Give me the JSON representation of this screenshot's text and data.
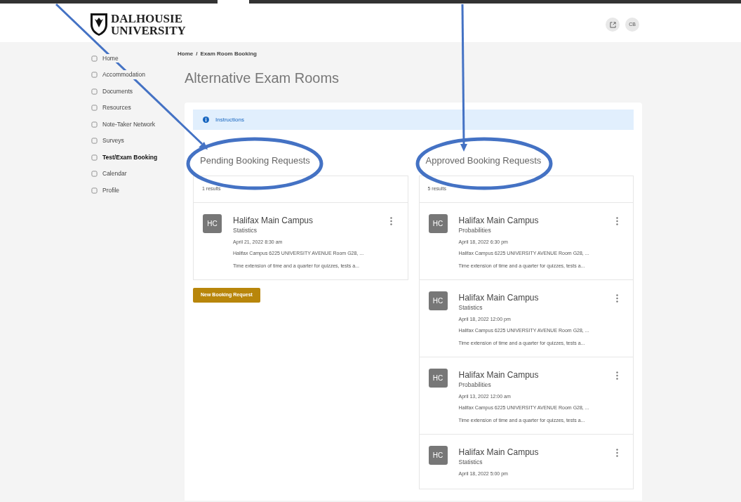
{
  "header": {
    "logo_line_1": "DALHOUSIE",
    "logo_line_2": "UNIVERSITY",
    "user_initials": "CB"
  },
  "sidebar": {
    "items": [
      {
        "label": "Home",
        "selected": false
      },
      {
        "label": "Accommodation",
        "selected": false
      },
      {
        "label": "Documents",
        "selected": false
      },
      {
        "label": "Resources",
        "selected": false
      },
      {
        "label": "Note-Taker Network",
        "selected": false
      },
      {
        "label": "Surveys",
        "selected": false
      },
      {
        "label": "Test/Exam Booking",
        "selected": true
      },
      {
        "label": "Calendar",
        "selected": false
      },
      {
        "label": "Profile",
        "selected": false
      }
    ]
  },
  "breadcrumb": [
    "Home",
    "/",
    "Exam Room Booking"
  ],
  "title": "Alternative Exam Rooms",
  "instructions": "Instructions",
  "columns": [
    {
      "heading": "Pending Booking Requests",
      "count": "1 results",
      "items": [
        {
          "initials": "HC",
          "campus": "Halifax Main Campus",
          "course": "Statistics",
          "date": "April 21, 2022 8:30 am",
          "location": "Halifax Campus 6225 UNIVERSITY AVENUE Room G28, ...",
          "note": "Time extension of time and a quarter for quizzes, tests a..."
        }
      ],
      "button": "New Booking Request"
    },
    {
      "heading": "Approved Booking Requests",
      "count": "5 results",
      "items": [
        {
          "initials": "HC",
          "campus": "Halifax Main Campus",
          "course": "Probabilities",
          "date": "April 18, 2022 6:30 pm",
          "location": "Halifax Campus 6225 UNIVERSITY AVENUE Room G28, ...",
          "note": "Time extension of time and a quarter for quizzes, tests a..."
        },
        {
          "initials": "HC",
          "campus": "Halifax Main Campus",
          "course": "Statistics",
          "date": "April 18, 2022 12:00 pm",
          "location": "Halifax Campus 6225 UNIVERSITY AVENUE Room G28, ...",
          "note": "Time extension of time and a quarter for quizzes, tests a..."
        },
        {
          "initials": "HC",
          "campus": "Halifax Main Campus",
          "course": "Probabilities",
          "date": "April 13, 2022 12:00 am",
          "location": "Halifax Campus 6225 UNIVERSITY AVENUE Room G28, ...",
          "note": "Time extension of time and a quarter for quizzes, tests a..."
        },
        {
          "initials": "HC",
          "campus": "Halifax Main Campus",
          "course": "Statistics",
          "date": "April 18, 2022 5:00 pm"
        }
      ]
    }
  ]
}
